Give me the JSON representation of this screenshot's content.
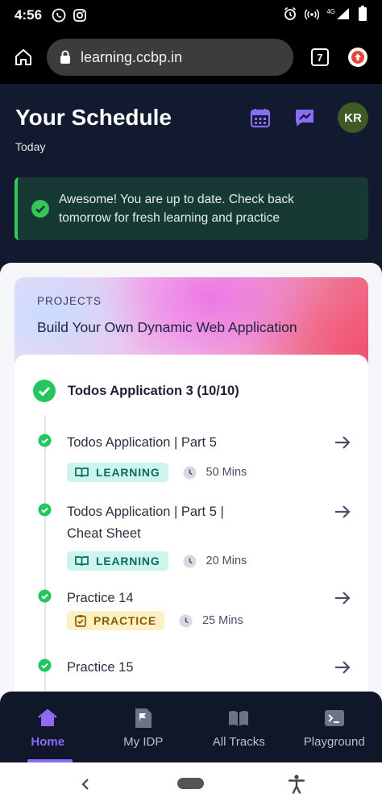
{
  "status_bar": {
    "time": "4:56",
    "network": "4G"
  },
  "browser": {
    "url": "learning.ccbp.in",
    "tab_count": "7"
  },
  "header": {
    "title": "Your Schedule",
    "subtitle": "Today",
    "avatar_initials": "KR"
  },
  "alert": {
    "text": "Awesome! You are up to date. Check back tomorrow for fresh learning and practice",
    "color": "#34c759"
  },
  "project": {
    "label": "PROJECTS",
    "title": "Build Your Own Dynamic Web Application",
    "module": {
      "title": "Todos Application 3 (10/10)",
      "items": [
        {
          "title": "Todos Application | Part 5",
          "type": "LEARNING",
          "duration": "50 Mins",
          "completed": true
        },
        {
          "title": "Todos Application | Part 5 | Cheat Sheet",
          "type": "LEARNING",
          "duration": "20 Mins",
          "completed": true
        },
        {
          "title": "Practice 14",
          "type": "PRACTICE",
          "duration": "25 Mins",
          "completed": true
        },
        {
          "title": "Practice 15",
          "type": "",
          "duration": "",
          "completed": true
        }
      ]
    }
  },
  "bottom_nav": {
    "items": [
      {
        "label": "Home",
        "icon": "home-icon",
        "active": true
      },
      {
        "label": "My IDP",
        "icon": "flag-document-icon",
        "active": false
      },
      {
        "label": "All Tracks",
        "icon": "open-book-icon",
        "active": false
      },
      {
        "label": "Playground",
        "icon": "terminal-icon",
        "active": false
      }
    ]
  },
  "colors": {
    "accent": "#8b6cf7",
    "success": "#34c759",
    "learning_badge_bg": "#ccf5ee",
    "practice_badge_bg": "#fdf1c4"
  }
}
